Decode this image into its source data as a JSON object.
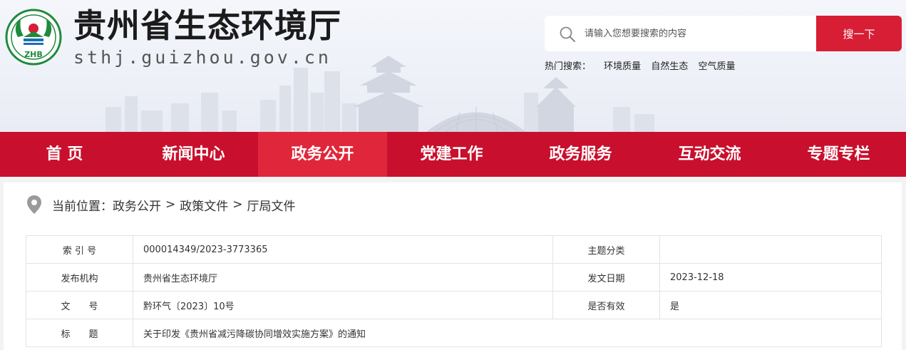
{
  "header": {
    "site_title": "贵州省生态环境厅",
    "site_url": "sthj.guizhou.gov.cn",
    "logo_text": "ZHB"
  },
  "search": {
    "placeholder": "请输入您想要搜索的内容",
    "button_label": "搜一下"
  },
  "hot_search": {
    "label": "热门搜索：",
    "items": [
      "环境质量",
      "自然生态",
      "空气质量"
    ]
  },
  "nav": {
    "items": [
      "首 页",
      "新闻中心",
      "政务公开",
      "党建工作",
      "政务服务",
      "互动交流",
      "专题专栏"
    ],
    "active_index": 2
  },
  "breadcrumb": {
    "prefix": "当前位置：",
    "items": [
      "政务公开",
      "政策文件",
      "厅局文件"
    ],
    "separator": ">"
  },
  "info_table": {
    "rows": [
      {
        "label1": "索 引 号",
        "value1": "000014349/2023-3773365",
        "label2": "主题分类",
        "value2": ""
      },
      {
        "label1": "发布机构",
        "value1": "贵州省生态环境厅",
        "label2": "发文日期",
        "value2": "2023-12-18"
      },
      {
        "label1": "文　　号",
        "value1": "黔环气〔2023〕10号",
        "label2": "是否有效",
        "value2": "是"
      },
      {
        "label1": "标　　题",
        "value1": "关于印发《贵州省减污降碳协同增效实施方案》的通知"
      }
    ]
  },
  "colors": {
    "nav_bg": "#c8102e",
    "nav_active": "#e0263b",
    "search_button": "#d71e35",
    "logo_green": "#1e8a3c"
  },
  "icons": [
    "search-icon",
    "location-pin-icon",
    "emblem-logo"
  ]
}
